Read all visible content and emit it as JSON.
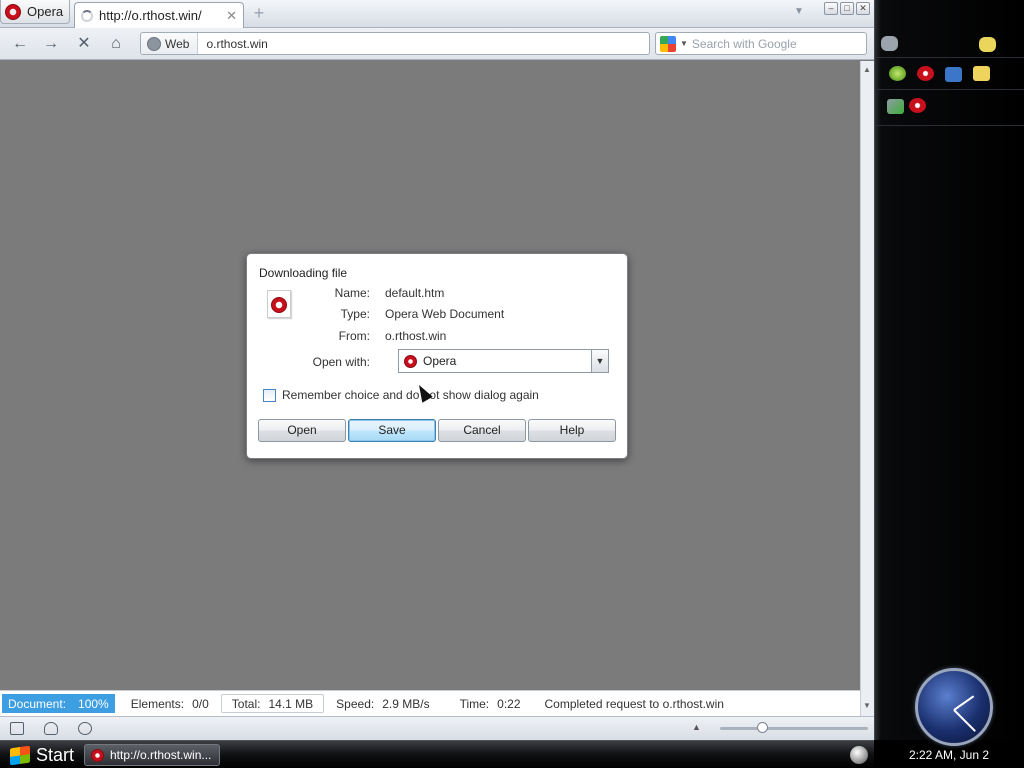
{
  "browser": {
    "menu_label": "Opera",
    "tab": {
      "title": "http://o.rthost.win/",
      "close": "✕"
    },
    "new_tab": "+",
    "nav": {
      "back": "←",
      "forward": "→",
      "stop": "✕",
      "home": "⌂"
    },
    "address": {
      "zone_label": "Web",
      "value": "o.rthost.win"
    },
    "search": {
      "placeholder": "Search with Google"
    }
  },
  "dialog": {
    "title": "Downloading file",
    "name_label": "Name:",
    "name_value": "default.htm",
    "type_label": "Type:",
    "type_value": "Opera Web Document",
    "from_label": "From:",
    "from_value": "o.rthost.win",
    "open_with_label": "Open with:",
    "open_with_value": "Opera",
    "remember_label": "Remember choice and do not show dialog again",
    "remember_checked": false,
    "buttons": {
      "open": "Open",
      "save": "Save",
      "cancel": "Cancel",
      "help": "Help"
    }
  },
  "statusbar": {
    "document_label": "Document:",
    "document_value": "100%",
    "elements_label": "Elements:",
    "elements_value": "0/0",
    "total_label": "Total:",
    "total_value": "14.1 MB",
    "speed_label": "Speed:",
    "speed_value": "2.9 MB/s",
    "time_label": "Time:",
    "time_value": "0:22",
    "message": "Completed request to o.rthost.win"
  },
  "zoom_level_fraction": 0.27,
  "taskbar": {
    "start_label": "Start",
    "task_label": "http://o.rthost.win..."
  },
  "clock": {
    "label": "2:22 AM, Jun 2"
  },
  "colors": {
    "opera_red": "#c8101c",
    "status_highlight": "#3d9ee2",
    "content_gray": "#7b7b7b"
  }
}
